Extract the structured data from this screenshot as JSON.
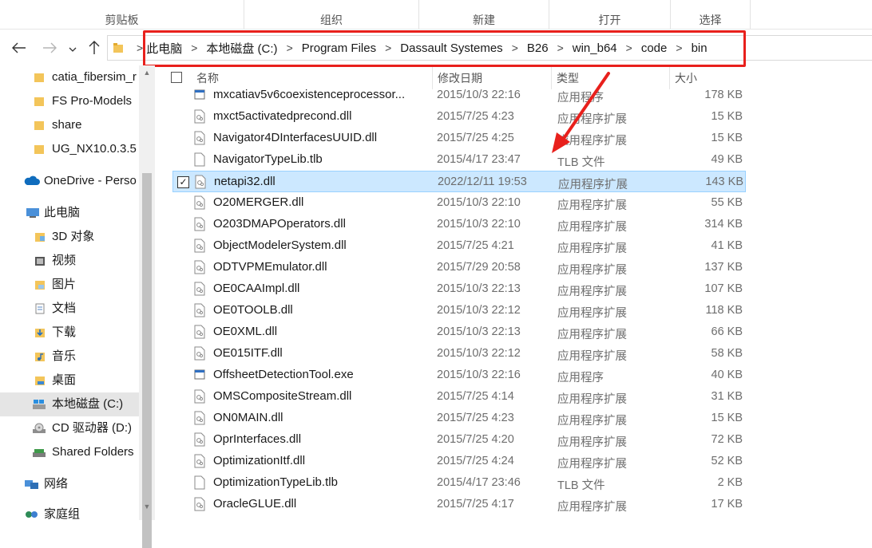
{
  "ribbon": {
    "groups": [
      "剪贴板",
      "组织",
      "新建",
      "打开",
      "选择"
    ]
  },
  "address": {
    "crumbs": [
      "此电脑",
      "本地磁盘 (C:)",
      "Program Files",
      "Dassault Systemes",
      "B26",
      "win_b64",
      "code",
      "bin"
    ],
    "separator": ">"
  },
  "nav": {
    "back_icon": "arrow-left-icon",
    "forward_icon": "arrow-right-icon",
    "recent_icon": "chevron-down-icon",
    "up_icon": "arrow-up-icon"
  },
  "sidebar": {
    "items": [
      {
        "label": "catia_fibersim_r",
        "icon": "folder-icon"
      },
      {
        "label": "FS Pro-Models",
        "icon": "folder-icon"
      },
      {
        "label": "share",
        "icon": "folder-icon"
      },
      {
        "label": "UG_NX10.0.3.5",
        "icon": "folder-icon"
      },
      {
        "label": "OneDrive - Perso",
        "icon": "cloud-icon"
      },
      {
        "label": "此电脑",
        "icon": "computer-icon"
      },
      {
        "label": "3D 对象",
        "icon": "3d-objects-icon"
      },
      {
        "label": "视频",
        "icon": "video-icon"
      },
      {
        "label": "图片",
        "icon": "pictures-icon"
      },
      {
        "label": "文档",
        "icon": "documents-icon"
      },
      {
        "label": "下载",
        "icon": "download-icon"
      },
      {
        "label": "音乐",
        "icon": "music-icon"
      },
      {
        "label": "桌面",
        "icon": "desktop-icon"
      },
      {
        "label": "本地磁盘 (C:)",
        "icon": "drive-icon"
      },
      {
        "label": "CD 驱动器 (D:)",
        "icon": "cd-drive-icon"
      },
      {
        "label": "Shared Folders",
        "icon": "shared-folder-icon"
      },
      {
        "label": "网络",
        "icon": "network-icon"
      },
      {
        "label": "家庭组",
        "icon": "homegroup-icon"
      }
    ]
  },
  "columns": {
    "name": "名称",
    "date": "修改日期",
    "type": "类型",
    "size": "大小"
  },
  "files": [
    {
      "name": "mxcatiav5v6coexistenceprocessor...",
      "date": "2015/10/3 22:16",
      "type": "应用程序",
      "size": "178 KB",
      "icon": "exe"
    },
    {
      "name": "mxct5activatedprecond.dll",
      "date": "2015/7/25 4:23",
      "type": "应用程序扩展",
      "size": "15 KB",
      "icon": "dll"
    },
    {
      "name": "Navigator4DInterfacesUUID.dll",
      "date": "2015/7/25 4:25",
      "type": "应用程序扩展",
      "size": "15 KB",
      "icon": "dll"
    },
    {
      "name": "NavigatorTypeLib.tlb",
      "date": "2015/4/17 23:47",
      "type": "TLB 文件",
      "size": "49 KB",
      "icon": "file"
    },
    {
      "name": "netapi32.dll",
      "date": "2022/12/11 19:53",
      "type": "应用程序扩展",
      "size": "143 KB",
      "icon": "dll",
      "selected": true
    },
    {
      "name": "O20MERGER.dll",
      "date": "2015/10/3 22:10",
      "type": "应用程序扩展",
      "size": "55 KB",
      "icon": "dll"
    },
    {
      "name": "O203DMAPOperators.dll",
      "date": "2015/10/3 22:10",
      "type": "应用程序扩展",
      "size": "314 KB",
      "icon": "dll"
    },
    {
      "name": "ObjectModelerSystem.dll",
      "date": "2015/7/25 4:21",
      "type": "应用程序扩展",
      "size": "41 KB",
      "icon": "dll"
    },
    {
      "name": "ODTVPMEmulator.dll",
      "date": "2015/7/29 20:58",
      "type": "应用程序扩展",
      "size": "137 KB",
      "icon": "dll"
    },
    {
      "name": "OE0CAAImpl.dll",
      "date": "2015/10/3 22:13",
      "type": "应用程序扩展",
      "size": "107 KB",
      "icon": "dll"
    },
    {
      "name": "OE0TOOLB.dll",
      "date": "2015/10/3 22:12",
      "type": "应用程序扩展",
      "size": "118 KB",
      "icon": "dll"
    },
    {
      "name": "OE0XML.dll",
      "date": "2015/10/3 22:13",
      "type": "应用程序扩展",
      "size": "66 KB",
      "icon": "dll"
    },
    {
      "name": "OE015ITF.dll",
      "date": "2015/10/3 22:12",
      "type": "应用程序扩展",
      "size": "58 KB",
      "icon": "dll"
    },
    {
      "name": "OffsheetDetectionTool.exe",
      "date": "2015/10/3 22:16",
      "type": "应用程序",
      "size": "40 KB",
      "icon": "exe"
    },
    {
      "name": "OMSCompositeStream.dll",
      "date": "2015/7/25 4:14",
      "type": "应用程序扩展",
      "size": "31 KB",
      "icon": "dll"
    },
    {
      "name": "ON0MAIN.dll",
      "date": "2015/7/25 4:23",
      "type": "应用程序扩展",
      "size": "15 KB",
      "icon": "dll"
    },
    {
      "name": "OprInterfaces.dll",
      "date": "2015/7/25 4:20",
      "type": "应用程序扩展",
      "size": "72 KB",
      "icon": "dll"
    },
    {
      "name": "OptimizationItf.dll",
      "date": "2015/7/25 4:24",
      "type": "应用程序扩展",
      "size": "52 KB",
      "icon": "dll"
    },
    {
      "name": "OptimizationTypeLib.tlb",
      "date": "2015/4/17 23:46",
      "type": "TLB 文件",
      "size": "2 KB",
      "icon": "file"
    },
    {
      "name": "OracleGLUE.dll",
      "date": "2015/7/25 4:17",
      "type": "应用程序扩展",
      "size": "17 KB",
      "icon": "dll"
    }
  ],
  "colors": {
    "highlight_box": "#e8201c",
    "annotation_arrow": "#e8201c",
    "selection_bg": "#cce8ff",
    "selection_border": "#99d1ff",
    "folder": "#f3c55a"
  }
}
